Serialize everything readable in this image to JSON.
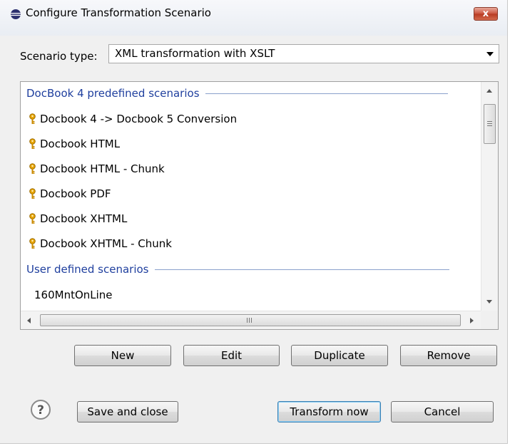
{
  "window": {
    "title": "Configure Transformation Scenario",
    "close_label": "x"
  },
  "scenario_type": {
    "label": "Scenario type:",
    "value": "XML transformation with XSLT"
  },
  "list": {
    "groups": [
      {
        "header": "DocBook 4 predefined scenarios",
        "items": [
          "Docbook 4 -> Docbook 5 Conversion",
          "Docbook HTML",
          "Docbook HTML - Chunk",
          "Docbook PDF",
          "Docbook XHTML",
          "Docbook XHTML - Chunk"
        ]
      },
      {
        "header": "User defined scenarios",
        "items": [
          "160MntOnLine"
        ]
      }
    ]
  },
  "actions": {
    "new": "New",
    "edit": "Edit",
    "duplicate": "Duplicate",
    "remove": "Remove"
  },
  "footer": {
    "save_close": "Save and close",
    "transform_now": "Transform now",
    "cancel": "Cancel"
  },
  "icons": {
    "app": "eclipse-icon",
    "item": "key-icon",
    "help": "help-icon"
  },
  "colors": {
    "group_header": "#1f3f9e",
    "key": "#e8a400",
    "default_button_border": "#3c7fb1"
  }
}
